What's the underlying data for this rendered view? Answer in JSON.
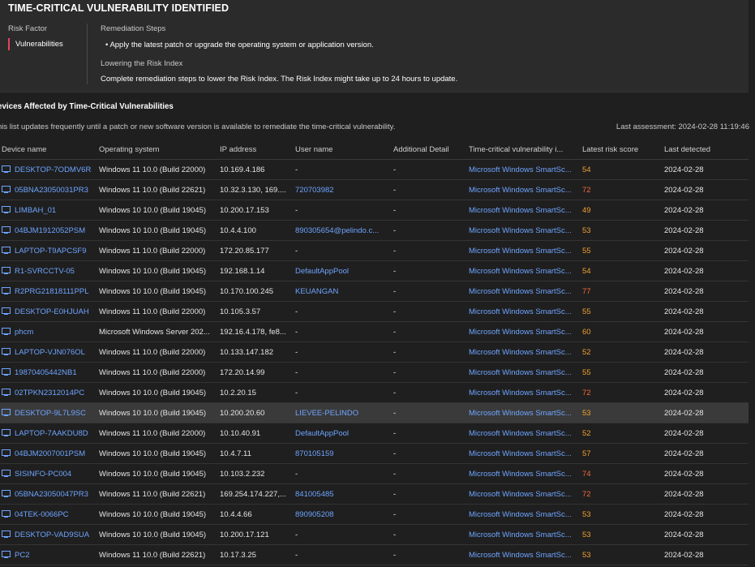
{
  "panel": {
    "title": "TIME-CRITICAL VULNERABILITY IDENTIFIED",
    "risk_factor_label": "Risk Factor",
    "risk_factor_value": "Vulnerabilities",
    "remediation_label": "Remediation Steps",
    "remediation_step": "• Apply the latest patch or upgrade the operating system or application version.",
    "lowering_label": "Lowering the Risk Index",
    "lowering_text": "Complete remediation steps to lower the Risk Index. The Risk Index might take up to 24 hours to update."
  },
  "section": {
    "title": "evices Affected by Time-Critical Vulnerabilities",
    "description": "his list updates frequently until a patch or new software version is available to remediate the time-critical vulnerability.",
    "last_assessment": "Last assessment: 2024-02-28 11:19:46"
  },
  "table": {
    "headers": {
      "device": "Device name",
      "os": "Operating system",
      "ip": "IP address",
      "user": "User name",
      "additional": "Additional Detail",
      "vuln": "Time-critical vulnerability i...",
      "score": "Latest risk score",
      "detected": "Last detected"
    },
    "rows": [
      {
        "device": "DESKTOP-7ODMV6R",
        "os": "Windows 11 10.0 (Build 22000)",
        "ip": "10.169.4.186",
        "user": "-",
        "user_link": false,
        "additional": "-",
        "vuln": "Microsoft Windows SmartSc...",
        "score": "54",
        "score_color": "#f0a030",
        "detected": "2024-02-28"
      },
      {
        "device": "05BNA23050031PR3",
        "os": "Windows 11 10.0 (Build 22621)",
        "ip": "10.32.3.130, 169....",
        "user": "720703982",
        "user_link": true,
        "additional": "-",
        "vuln": "Microsoft Windows SmartSc...",
        "score": "72",
        "score_color": "#f06a3a",
        "detected": "2024-02-28"
      },
      {
        "device": "LIMBAH_01",
        "os": "Windows 10 10.0 (Build 19045)",
        "ip": "10.200.17.153",
        "user": "-",
        "user_link": false,
        "additional": "-",
        "vuln": "Microsoft Windows SmartSc...",
        "score": "49",
        "score_color": "#f0a030",
        "detected": "2024-02-28"
      },
      {
        "device": "04BJM1912052PSM",
        "os": "Windows 10 10.0 (Build 19045)",
        "ip": "10.4.4.100",
        "user": "890305654@pelindo.c...",
        "user_link": true,
        "additional": "-",
        "vuln": "Microsoft Windows SmartSc...",
        "score": "53",
        "score_color": "#f0a030",
        "detected": "2024-02-28"
      },
      {
        "device": "LAPTOP-T9APCSF9",
        "os": "Windows 11 10.0 (Build 22000)",
        "ip": "172.20.85.177",
        "user": "-",
        "user_link": false,
        "additional": "-",
        "vuln": "Microsoft Windows SmartSc...",
        "score": "55",
        "score_color": "#f0a030",
        "detected": "2024-02-28"
      },
      {
        "device": "R1-SVRCCTV-05",
        "os": "Windows 10 10.0 (Build 19045)",
        "ip": "192.168.1.14",
        "user": "DefaultAppPool",
        "user_link": true,
        "additional": "-",
        "vuln": "Microsoft Windows SmartSc...",
        "score": "54",
        "score_color": "#f0a030",
        "detected": "2024-02-28"
      },
      {
        "device": "R2PRG21818111PPL",
        "os": "Windows 10 10.0 (Build 19045)",
        "ip": "10.170.100.245",
        "user": "KEUANGAN",
        "user_link": true,
        "additional": "-",
        "vuln": "Microsoft Windows SmartSc...",
        "score": "77",
        "score_color": "#f06a3a",
        "detected": "2024-02-28"
      },
      {
        "device": "DESKTOP-E0HJUAH",
        "os": "Windows 11 10.0 (Build 22000)",
        "ip": "10.105.3.57",
        "user": "-",
        "user_link": false,
        "additional": "-",
        "vuln": "Microsoft Windows SmartSc...",
        "score": "55",
        "score_color": "#f0a030",
        "detected": "2024-02-28"
      },
      {
        "device": "phcm",
        "os": "Microsoft Windows Server 202...",
        "ip": "192.16.4.178, fe8...",
        "user": "-",
        "user_link": false,
        "additional": "-",
        "vuln": "Microsoft Windows SmartSc...",
        "score": "60",
        "score_color": "#f0a030",
        "detected": "2024-02-28"
      },
      {
        "device": "LAPTOP-VJN076OL",
        "os": "Windows 11 10.0 (Build 22000)",
        "ip": "10.133.147.182",
        "user": "-",
        "user_link": false,
        "additional": "-",
        "vuln": "Microsoft Windows SmartSc...",
        "score": "52",
        "score_color": "#f0a030",
        "detected": "2024-02-28"
      },
      {
        "device": "19870405442NB1",
        "os": "Windows 11 10.0 (Build 22000)",
        "ip": "172.20.14.99",
        "user": "-",
        "user_link": false,
        "additional": "-",
        "vuln": "Microsoft Windows SmartSc...",
        "score": "55",
        "score_color": "#f0a030",
        "detected": "2024-02-28"
      },
      {
        "device": "02TPKN2312014PC",
        "os": "Windows 10 10.0 (Build 19045)",
        "ip": "10.2.20.15",
        "user": "-",
        "user_link": false,
        "additional": "-",
        "vuln": "Microsoft Windows SmartSc...",
        "score": "72",
        "score_color": "#f06a3a",
        "detected": "2024-02-28"
      },
      {
        "device": "DESKTOP-9L7L9SC",
        "os": "Windows 10 10.0 (Build 19045)",
        "ip": "10.200.20.60",
        "user": "LIEVEE-PELINDO",
        "user_link": true,
        "additional": "-",
        "vuln": "Microsoft Windows SmartSc...",
        "score": "53",
        "score_color": "#f0a030",
        "detected": "2024-02-28",
        "selected": true
      },
      {
        "device": "LAPTOP-7AAKDU8D",
        "os": "Windows 11 10.0 (Build 22000)",
        "ip": "10.10.40.91",
        "user": "DefaultAppPool",
        "user_link": true,
        "additional": "-",
        "vuln": "Microsoft Windows SmartSc...",
        "score": "52",
        "score_color": "#f0a030",
        "detected": "2024-02-28"
      },
      {
        "device": "04BJM2007001PSM",
        "os": "Windows 10 10.0 (Build 19045)",
        "ip": "10.4.7.11",
        "user": "870105159",
        "user_link": true,
        "additional": "-",
        "vuln": "Microsoft Windows SmartSc...",
        "score": "57",
        "score_color": "#f0a030",
        "detected": "2024-02-28"
      },
      {
        "device": "SISINFO-PC004",
        "os": "Windows 10 10.0 (Build 19045)",
        "ip": "10.103.2.232",
        "user": "-",
        "user_link": false,
        "additional": "-",
        "vuln": "Microsoft Windows SmartSc...",
        "score": "74",
        "score_color": "#f06a3a",
        "detected": "2024-02-28"
      },
      {
        "device": "05BNA23050047PR3",
        "os": "Windows 11 10.0 (Build 22621)",
        "ip": "169.254.174.227,...",
        "user": "841005485",
        "user_link": true,
        "additional": "-",
        "vuln": "Microsoft Windows SmartSc...",
        "score": "72",
        "score_color": "#f06a3a",
        "detected": "2024-02-28"
      },
      {
        "device": "04TEK-0066PC",
        "os": "Windows 10 10.0 (Build 19045)",
        "ip": "10.4.4.66",
        "user": "890905208",
        "user_link": true,
        "additional": "-",
        "vuln": "Microsoft Windows SmartSc...",
        "score": "53",
        "score_color": "#f0a030",
        "detected": "2024-02-28"
      },
      {
        "device": "DESKTOP-VAD9SUA",
        "os": "Windows 10 10.0 (Build 19045)",
        "ip": "10.200.17.121",
        "user": "-",
        "user_link": false,
        "additional": "-",
        "vuln": "Microsoft Windows SmartSc...",
        "score": "53",
        "score_color": "#f0a030",
        "detected": "2024-02-28"
      },
      {
        "device": "PC2",
        "os": "Windows 11 10.0 (Build 22621)",
        "ip": "10.17.3.25",
        "user": "-",
        "user_link": false,
        "additional": "-",
        "vuln": "Microsoft Windows SmartSc...",
        "score": "53",
        "score_color": "#f0a030",
        "detected": "2024-02-28"
      }
    ]
  }
}
